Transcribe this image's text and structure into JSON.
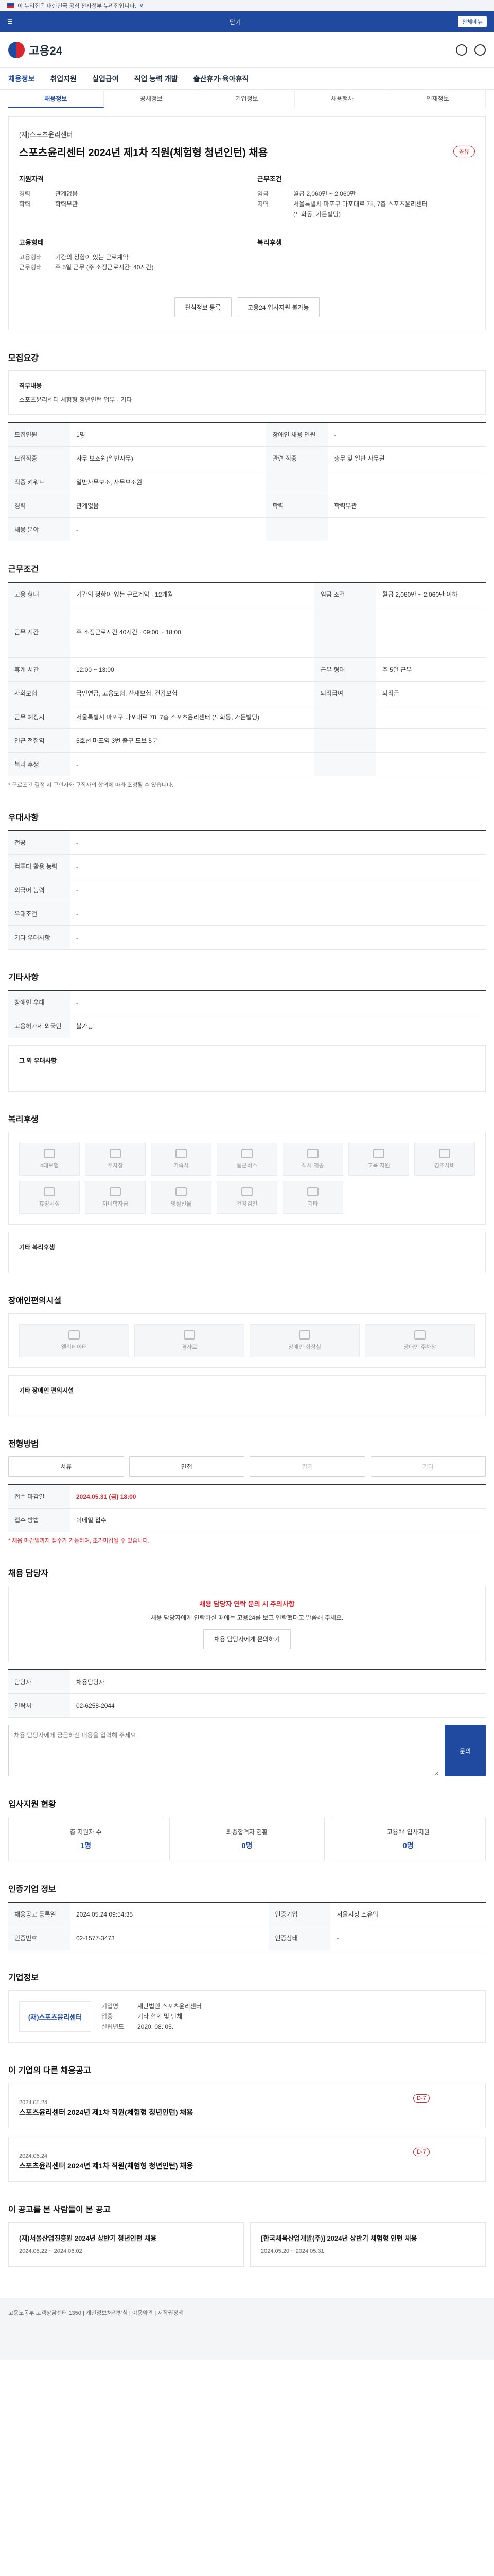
{
  "gov": {
    "text": "이 누리집은 대한민국 공식 전자정부 누리집입니다.",
    "link": "∨"
  },
  "topbar": {
    "center": "닫기",
    "pill": "전체메뉴"
  },
  "brand": {
    "name": "고용24"
  },
  "nav": [
    "채용정보",
    "취업지원",
    "실업급여",
    "직업 능력 개발",
    "출산휴가·육아휴직"
  ],
  "subnav": [
    "채용정보",
    "공채정보",
    "기업정보",
    "채용행사",
    "인재정보"
  ],
  "job": {
    "company": "(재)스포츠윤리센터",
    "title": "스포츠윤리센터 2024년 제1차 직원(체험형 청년인턴) 채용",
    "share": "공유",
    "left": {
      "heading": "지원자격",
      "rows": [
        {
          "k": "경력",
          "v": "관계없음"
        },
        {
          "k": "학력",
          "v": "학력무관"
        }
      ]
    },
    "right": {
      "heading": "근무조건",
      "rows": [
        {
          "k": "임금",
          "v": "월급 2,060만 ~ 2,060만"
        },
        {
          "k": "지역",
          "v": "서울특별시 마포구 마포대로 78, 7층 스포츠윤리센터"
        },
        {
          "k": "",
          "v": "(도화동, 가든빌딩)"
        }
      ]
    },
    "left2": {
      "heading": "고용형태",
      "rows": [
        {
          "k": "고용형태",
          "v": "기간의 정함이 있는 근로계약"
        },
        {
          "k": "근무형태",
          "v": "주 5일 근무 (주 소정근로시간: 40시간)"
        }
      ]
    },
    "right2": {
      "heading": "복리후생",
      "rows": []
    },
    "buttons": {
      "scrap": "관심정보 등록",
      "apply": "고용24 입사지원 불가능"
    }
  },
  "sections": {
    "recruit": "모집요강",
    "duty_label": "직무내용",
    "duty": "스포츠윤리센터 체험형 청년인턴 업무 · 기타",
    "table1": [
      {
        "k": "모집인원",
        "v": "1명",
        "k2": "장애인 채용 인원",
        "v2": "-"
      },
      {
        "k": "모집직종",
        "v": "사무 보조원(일반사무)",
        "k2": "관련 직종",
        "v2": "총무 및 일반 사무원"
      },
      {
        "k": "직종 키워드",
        "v": "일반사무보조, 사무보조원",
        "k2": "",
        "v2": ""
      },
      {
        "k": "경력",
        "v": "관계없음",
        "k2": "학력",
        "v2": "학력무관"
      },
      {
        "k": "채용 분야",
        "v": "-",
        "k2": "",
        "v2": ""
      }
    ],
    "conditions": "근무조건",
    "table2": [
      {
        "k": "고용 형태",
        "v": "기간의 정함이 있는 근로계약 · 12개월",
        "k2": "임금 조건",
        "v2": "월급 2,060만 ~ 2,060만 이하"
      },
      {
        "k": "근무 시간",
        "v": "주 소정근로시간 40시간 · 09:00 ~ 18:00",
        "k2": "",
        "v2": ""
      },
      {
        "k": "휴게 시간",
        "v": "12:00 ~ 13:00",
        "k2": "근무 형태",
        "v2": "주 5일 근무"
      },
      {
        "k": "사회보험",
        "v": "국민연금, 고용보험, 산재보험, 건강보험",
        "k2": "퇴직급여",
        "v2": "퇴직금"
      },
      {
        "k": "근무 예정지",
        "v": "서울특별시 마포구 마포대로 78, 7층 스포츠윤리센터 (도화동, 가든빌딩)",
        "k2": "",
        "v2": ""
      },
      {
        "k": "인근 전철역",
        "v": "5호선 마포역 3번 출구 도보 5분",
        "k2": "",
        "v2": ""
      },
      {
        "k": "복리 후생",
        "v": "-",
        "k2": "",
        "v2": ""
      }
    ],
    "cond_note": "* 근로조건 결정 시 구인자와 구직자의 합의에 따라 조정될 수 있습니다.",
    "prefer": "우대사항",
    "table3": [
      {
        "k": "전공",
        "v": "-"
      },
      {
        "k": "컴퓨터 활용 능력",
        "v": "-"
      },
      {
        "k": "외국어 능력",
        "v": "-"
      },
      {
        "k": "우대조건",
        "v": "-"
      },
      {
        "k": "기타 우대사항",
        "v": "-"
      }
    ],
    "other": "기타사항",
    "table4": [
      {
        "k": "장애인 우대",
        "v": "-"
      },
      {
        "k": "고용허가제 외국인",
        "v": "불가능"
      }
    ],
    "other_note": "그 외 우대사항",
    "welfare": "복리후생",
    "welfare_icons": [
      "4대보험",
      "주차장",
      "기숙사",
      "통근버스",
      "식사 제공",
      "교육 지원",
      "경조사비",
      "휴양시설",
      "자녀학자금",
      "명절선물",
      "건강검진",
      "기타"
    ],
    "welfare_note": "기타 복리후생",
    "disability": "장애인편의시설",
    "disability_icons": [
      "엘리베이터",
      "경사로",
      "장애인 화장실",
      "장애인 주차장"
    ],
    "disability_note": "기타 장애인 편의시설",
    "apply": "전형방법",
    "methods": [
      "서류",
      "면접",
      "필기",
      "기타"
    ],
    "apply_table": [
      {
        "k": "접수 마감일",
        "v": "2024.05.31 (금) 18:00"
      },
      {
        "k": "접수 방법",
        "v": "이메일 접수"
      }
    ],
    "apply_note": "* 채용 마감일까지 접수가 가능하며, 조기마감될 수 있습니다.",
    "contact": "채용 담당자",
    "alert_title": "채용 담당자 연락 문의 시 주의사항",
    "alert_text": "채용 담당자에게 연락하실 때에는 고용24를 보고 연락했다고 말씀해 주세요.",
    "contact_btn": "채용 담당자에게 문의하기",
    "contact_table": [
      {
        "k": "담당자",
        "v": "채용담당자"
      },
      {
        "k": "연락처",
        "v": "02-6258-2044"
      }
    ],
    "qna_placeholder": "채용 담당자에게 궁금하신 내용을 입력해 주세요.",
    "qna_btn": "문의",
    "status": "입사지원 현황",
    "stats": [
      {
        "lbl": "총 지원자 수",
        "val": "1명"
      },
      {
        "lbl": "최종합격자 현황",
        "val": "0명"
      },
      {
        "lbl": "고용24 입사지원",
        "val": "0명"
      }
    ],
    "info": "인증기업 정보",
    "info_table": [
      {
        "k": "채용공고 등록일",
        "v": "2024.05.24 09:54:35",
        "k2": "인증기업",
        "v2": "서울시청 소유의"
      },
      {
        "k": "인증번호",
        "v": "02-1577-3473",
        "k2": "인증상태",
        "v2": "-"
      }
    ],
    "company_info": "기업정보",
    "company_rows": [
      {
        "k": "기업명",
        "v": "재단법인 스포츠윤리센터"
      },
      {
        "k": "업종",
        "v": "기타 협회 및 단체"
      },
      {
        "k": "설립년도",
        "v": "2020. 08. 05."
      }
    ],
    "similar": "이 기업의 다른 채용공고",
    "jobs": [
      {
        "date": "2024.05.24",
        "title": "스포츠윤리센터 2024년 제1차 직원(체험형 청년인턴) 채용",
        "tag": "D-7"
      },
      {
        "date": "2024.05.24",
        "title": "스포츠윤리센터 2024년 제1차 직원(체험형 청년인턴) 채용",
        "tag": "D-7"
      }
    ],
    "recommend": "이 공고를 본 사람들이 본 공고",
    "rec": [
      {
        "title": "(재)서울산업진흥원 2024년 상반기 청년인턴 채용",
        "date": "2024.05.22 ~ 2024.06.02"
      },
      {
        "title": "[한국체육산업개발(주)] 2024년 상반기 체험형 인턴 채용",
        "date": "2024.05.20 ~ 2024.05.31"
      }
    ]
  },
  "footer": {
    "text": "고용노동부 고객상담센터 1350 | 개인정보처리방침 | 이용약관 | 저작권정책"
  }
}
